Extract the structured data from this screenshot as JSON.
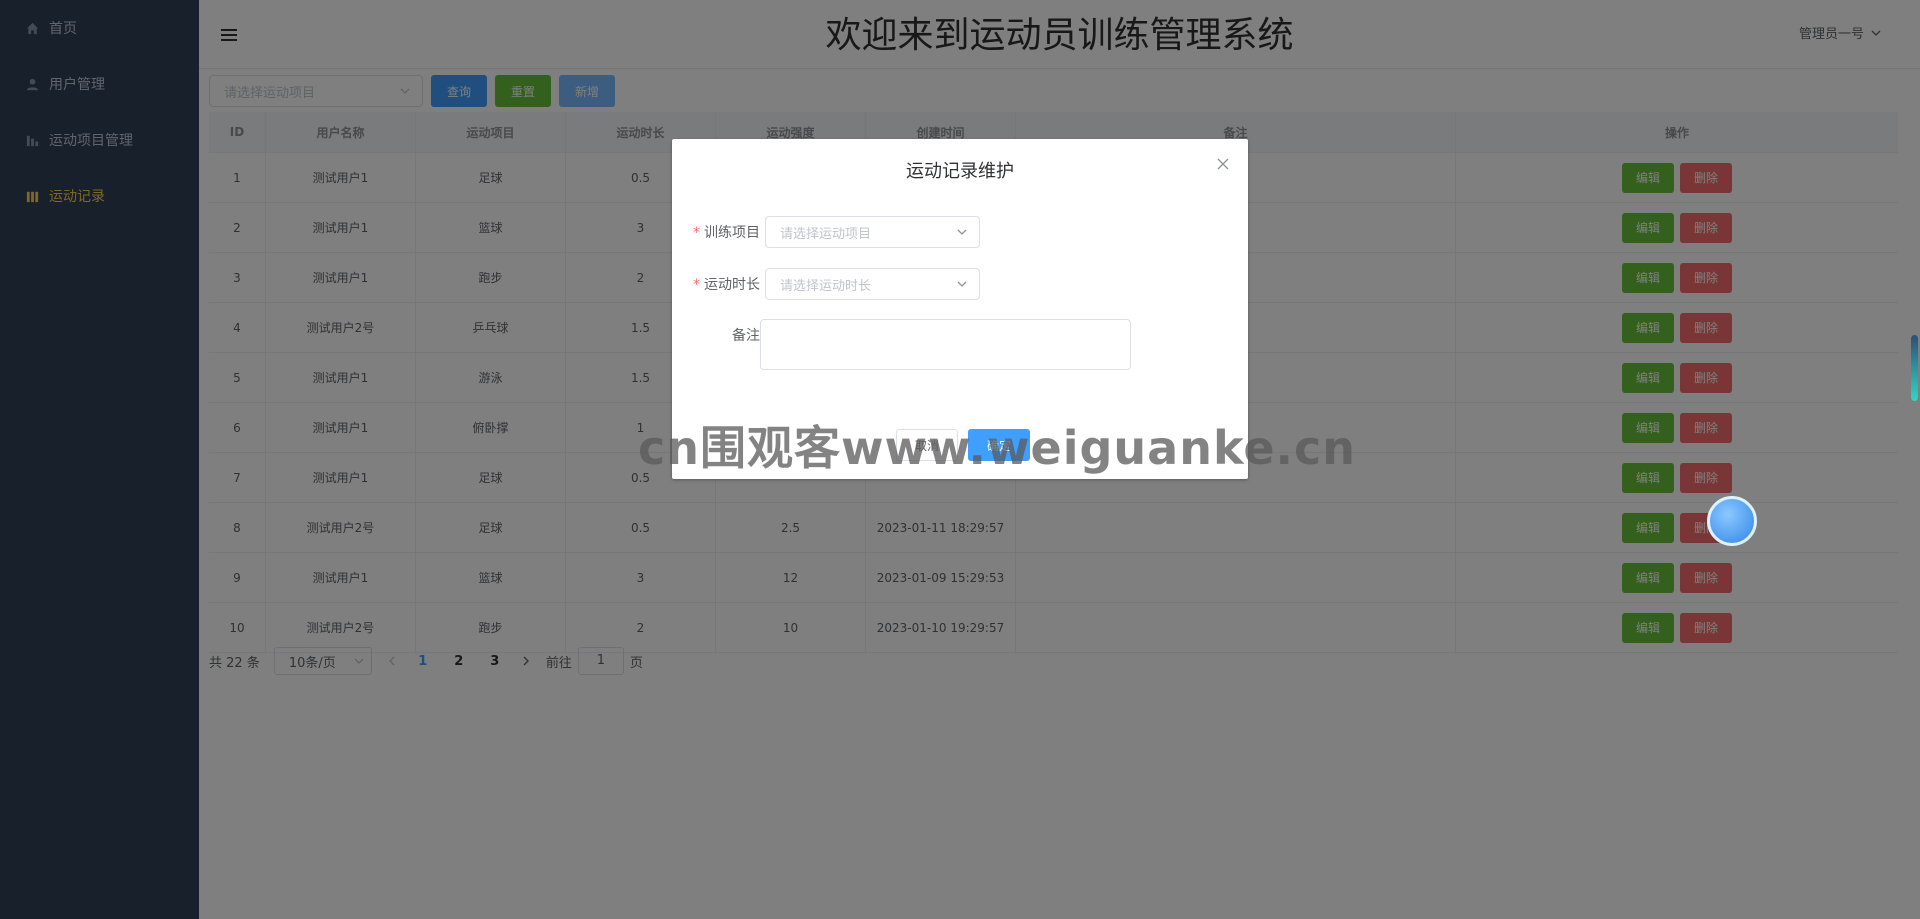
{
  "sidebar": {
    "items": [
      {
        "label": "首页",
        "icon": "home-icon",
        "active": false
      },
      {
        "label": "用户管理",
        "icon": "user-icon",
        "active": false
      },
      {
        "label": "运动项目管理",
        "icon": "chart-icon",
        "active": false
      },
      {
        "label": "运动记录",
        "icon": "chart-icon",
        "active": true
      }
    ]
  },
  "header": {
    "title": "欢迎来到运动员训练管理系统",
    "user": "管理员一号"
  },
  "toolbar": {
    "select_placeholder": "请选择运动项目",
    "query_label": "查询",
    "reset_label": "重置",
    "add_label": "新增"
  },
  "table": {
    "columns": [
      "ID",
      "用户名称",
      "运动项目",
      "运动时长",
      "运动强度",
      "创建时间",
      "备注",
      "操作"
    ],
    "rows": [
      {
        "id": "1",
        "user": "测试用户1",
        "sport": "足球",
        "duration": "0.5",
        "intensity": "",
        "created": "",
        "note": ""
      },
      {
        "id": "2",
        "user": "测试用户1",
        "sport": "篮球",
        "duration": "3",
        "intensity": "",
        "created": "",
        "note": ""
      },
      {
        "id": "3",
        "user": "测试用户1",
        "sport": "跑步",
        "duration": "2",
        "intensity": "",
        "created": "",
        "note": ""
      },
      {
        "id": "4",
        "user": "测试用户2号",
        "sport": "乒乓球",
        "duration": "1.5",
        "intensity": "",
        "created": "",
        "note": ""
      },
      {
        "id": "5",
        "user": "测试用户1",
        "sport": "游泳",
        "duration": "1.5",
        "intensity": "",
        "created": "",
        "note": ""
      },
      {
        "id": "6",
        "user": "测试用户1",
        "sport": "俯卧撑",
        "duration": "1",
        "intensity": "",
        "created": "",
        "note": ""
      },
      {
        "id": "7",
        "user": "测试用户1",
        "sport": "足球",
        "duration": "0.5",
        "intensity": "",
        "created": "",
        "note": ""
      },
      {
        "id": "8",
        "user": "测试用户2号",
        "sport": "足球",
        "duration": "0.5",
        "intensity": "2.5",
        "created": "2023-01-11 18:29:57",
        "note": ""
      },
      {
        "id": "9",
        "user": "测试用户1",
        "sport": "篮球",
        "duration": "3",
        "intensity": "12",
        "created": "2023-01-09 15:29:53",
        "note": ""
      },
      {
        "id": "10",
        "user": "测试用户2号",
        "sport": "跑步",
        "duration": "2",
        "intensity": "10",
        "created": "2023-01-10 19:29:57",
        "note": ""
      }
    ],
    "edit_label": "编辑",
    "delete_label": "删除"
  },
  "pagination": {
    "total_text": "共 22 条",
    "page_size": "10条/页",
    "pages": [
      "1",
      "2",
      "3"
    ],
    "current_page": "1",
    "goto_prefix": "前往",
    "goto_value": "1",
    "goto_suffix": "页"
  },
  "dialog": {
    "title": "运动记录维护",
    "fields": [
      {
        "label": "训练项目",
        "required": true,
        "placeholder": "请选择运动项目"
      },
      {
        "label": "运动时长",
        "required": true,
        "placeholder": "请选择运动时长"
      },
      {
        "label": "备注",
        "required": false,
        "placeholder": ""
      }
    ],
    "cancel_label": "取消",
    "ok_label": "确定"
  },
  "watermark": "cn围观客www.weiguanke.cn",
  "colors": {
    "sidebar_bg": "#304156",
    "active_menu": "#ffd04b",
    "primary": "#409eff",
    "success": "#67c23a",
    "danger": "#f56c6c"
  }
}
